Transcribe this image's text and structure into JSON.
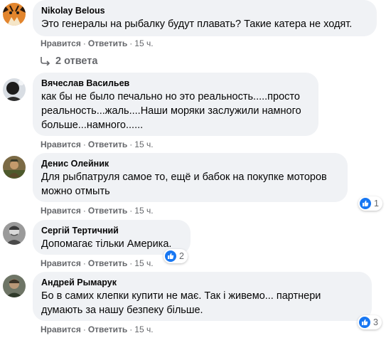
{
  "comments": [
    {
      "author": "Nikolay Belous",
      "text": "Это генералы на рыбалку будут плавать? Такие катера не ходят.",
      "like": "Нравится",
      "reply": "Ответить",
      "time": "15 ч.",
      "replies_label": "2 ответа"
    },
    {
      "author": "Вячеслав Васильев",
      "text": "как бы не было печально но это реальность.....просто\nреальность...жаль....Наши моряки заслужили намного\nбольше...намного......",
      "like": "Нравится",
      "reply": "Ответить",
      "time": "15 ч."
    },
    {
      "author": "Денис Олейник",
      "text": "Для рыбпатруля самое то, ещё и бабок на покупке моторов\nможно отмыть",
      "like": "Нравится",
      "reply": "Ответить",
      "time": "15 ч.",
      "reaction_count": "1"
    },
    {
      "author": "Сергій Тертичний",
      "text": "Допомагає тільки Америка.",
      "like": "Нравится",
      "reply": "Ответить",
      "time": "15 ч.",
      "reaction_count": "2"
    },
    {
      "author": "Андрей Рымарук",
      "text": "Бо в самих клепки купити не має. Так і живемо... партнери\nдумають за нашу безпеку більше.",
      "like": "Нравится",
      "reply": "Ответить",
      "time": "15 ч.",
      "reaction_count": "3"
    }
  ],
  "separator": "·",
  "colors": {
    "bubble": "#f0f2f5",
    "text": "#050505",
    "meta": "#65676b",
    "like_blue": "#1877f2"
  },
  "icons": {
    "reaction": "thumbs-up-icon",
    "replies": "reply-arrow-icon"
  }
}
